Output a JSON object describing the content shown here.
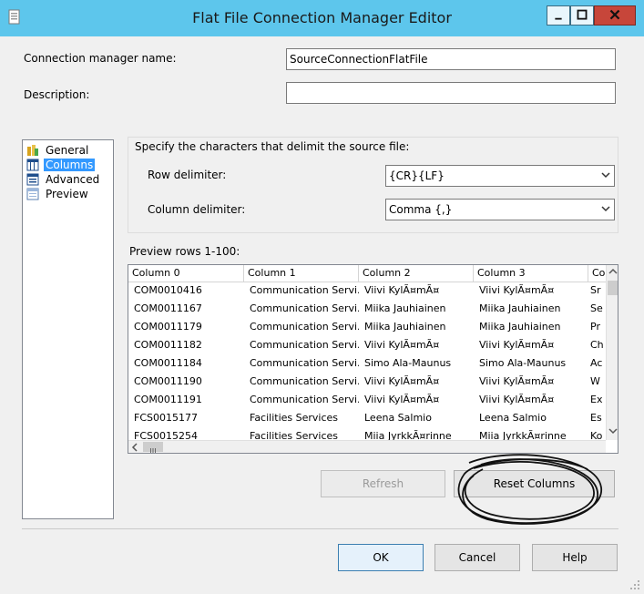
{
  "window": {
    "title": "Flat File Connection Manager Editor",
    "icons": [
      "app-icon",
      "minimize-icon",
      "maximize-icon",
      "close-icon"
    ]
  },
  "form": {
    "name_label": "Connection manager name:",
    "name_value": "SourceConnectionFlatFile",
    "description_label": "Description:",
    "description_value": ""
  },
  "nav": {
    "items": [
      {
        "label": "General",
        "icon": "general-icon"
      },
      {
        "label": "Columns",
        "icon": "columns-icon",
        "selected": true
      },
      {
        "label": "Advanced",
        "icon": "advanced-icon"
      },
      {
        "label": "Preview",
        "icon": "preview-icon"
      }
    ]
  },
  "delimiters": {
    "heading": "Specify the characters that delimit the source file:",
    "row_label": "Row delimiter:",
    "row_value": "{CR}{LF}",
    "column_label": "Column delimiter:",
    "column_value": "Comma {,}"
  },
  "preview": {
    "label": "Preview rows 1-100:",
    "columns": [
      "Column 0",
      "Column 1",
      "Column 2",
      "Column 3",
      "Co"
    ],
    "rows": [
      [
        "COM0010416",
        "Communication Servi...",
        "Viivi KylÃ¤mÃ¤",
        "Viivi KylÃ¤mÃ¤",
        "Sr"
      ],
      [
        "COM0011167",
        "Communication Servi...",
        "Miika Jauhiainen",
        "Miika Jauhiainen",
        "Se"
      ],
      [
        "COM0011179",
        "Communication Servi...",
        "Miika Jauhiainen",
        "Miika Jauhiainen",
        "Pr"
      ],
      [
        "COM0011182",
        "Communication Servi...",
        "Viivi KylÃ¤mÃ¤",
        "Viivi KylÃ¤mÃ¤",
        "Ch"
      ],
      [
        "COM0011184",
        "Communication Servi...",
        "Simo Ala-Maunus",
        "Simo Ala-Maunus",
        "Ac"
      ],
      [
        "COM0011190",
        "Communication Servi...",
        "Viivi KylÃ¤mÃ¤",
        "Viivi KylÃ¤mÃ¤",
        "W"
      ],
      [
        "COM0011191",
        "Communication Servi...",
        "Viivi KylÃ¤mÃ¤",
        "Viivi KylÃ¤mÃ¤",
        "Ex"
      ],
      [
        "FCS0015177",
        "Facilities Services",
        "Leena Salmio",
        "Leena Salmio",
        "Es"
      ],
      [
        "FCS0015254",
        "Facilities Services",
        "Miia JyrkkÃ¤rinne",
        "Miia JyrkkÃ¤rinne",
        "Ko"
      ]
    ]
  },
  "buttons": {
    "refresh": "Refresh",
    "reset_columns": "Reset Columns",
    "ok": "OK",
    "cancel": "Cancel",
    "help": "Help"
  },
  "colors": {
    "titlebar": "#5dc6ec",
    "selection": "#3399ff",
    "close_button": "#c7463a",
    "annotation": "#111111"
  }
}
